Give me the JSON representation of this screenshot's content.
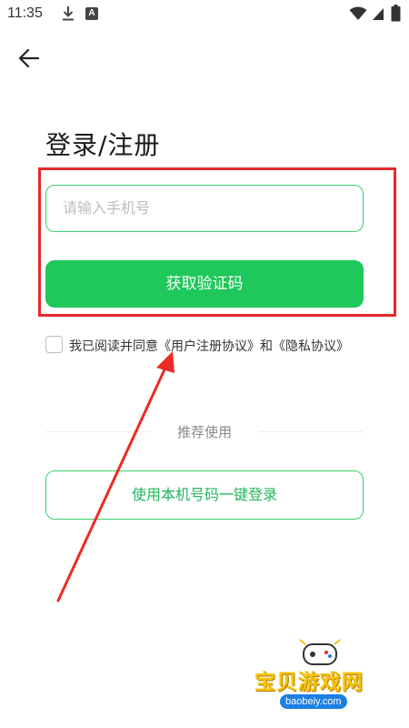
{
  "status_bar": {
    "time": "11:35",
    "icons": [
      "download-icon",
      "a-letter-icon",
      "wifi-icon",
      "signal-icon",
      "battery-icon"
    ]
  },
  "header": {
    "back_icon": "back-arrow-icon"
  },
  "title": "登录/注册",
  "phone_input": {
    "placeholder": "请输入手机号",
    "value": ""
  },
  "get_code_button": "获取验证码",
  "agreement": {
    "checked": false,
    "prefix": "我已阅读并同意",
    "user_agreement": "《用户注册协议》",
    "conjunction": "和",
    "privacy_policy": "《隐私协议》"
  },
  "recommend_label": "推荐使用",
  "one_key_login_button": "使用本机号码一键登录",
  "watermark": {
    "title": "宝贝游戏网",
    "subtitle": "baobeiy.com"
  },
  "colors": {
    "primary_green": "#1ec85a",
    "border_green": "#3ad16a",
    "annotation_red": "#e8282b",
    "placeholder_gray": "#bdbdbd"
  }
}
